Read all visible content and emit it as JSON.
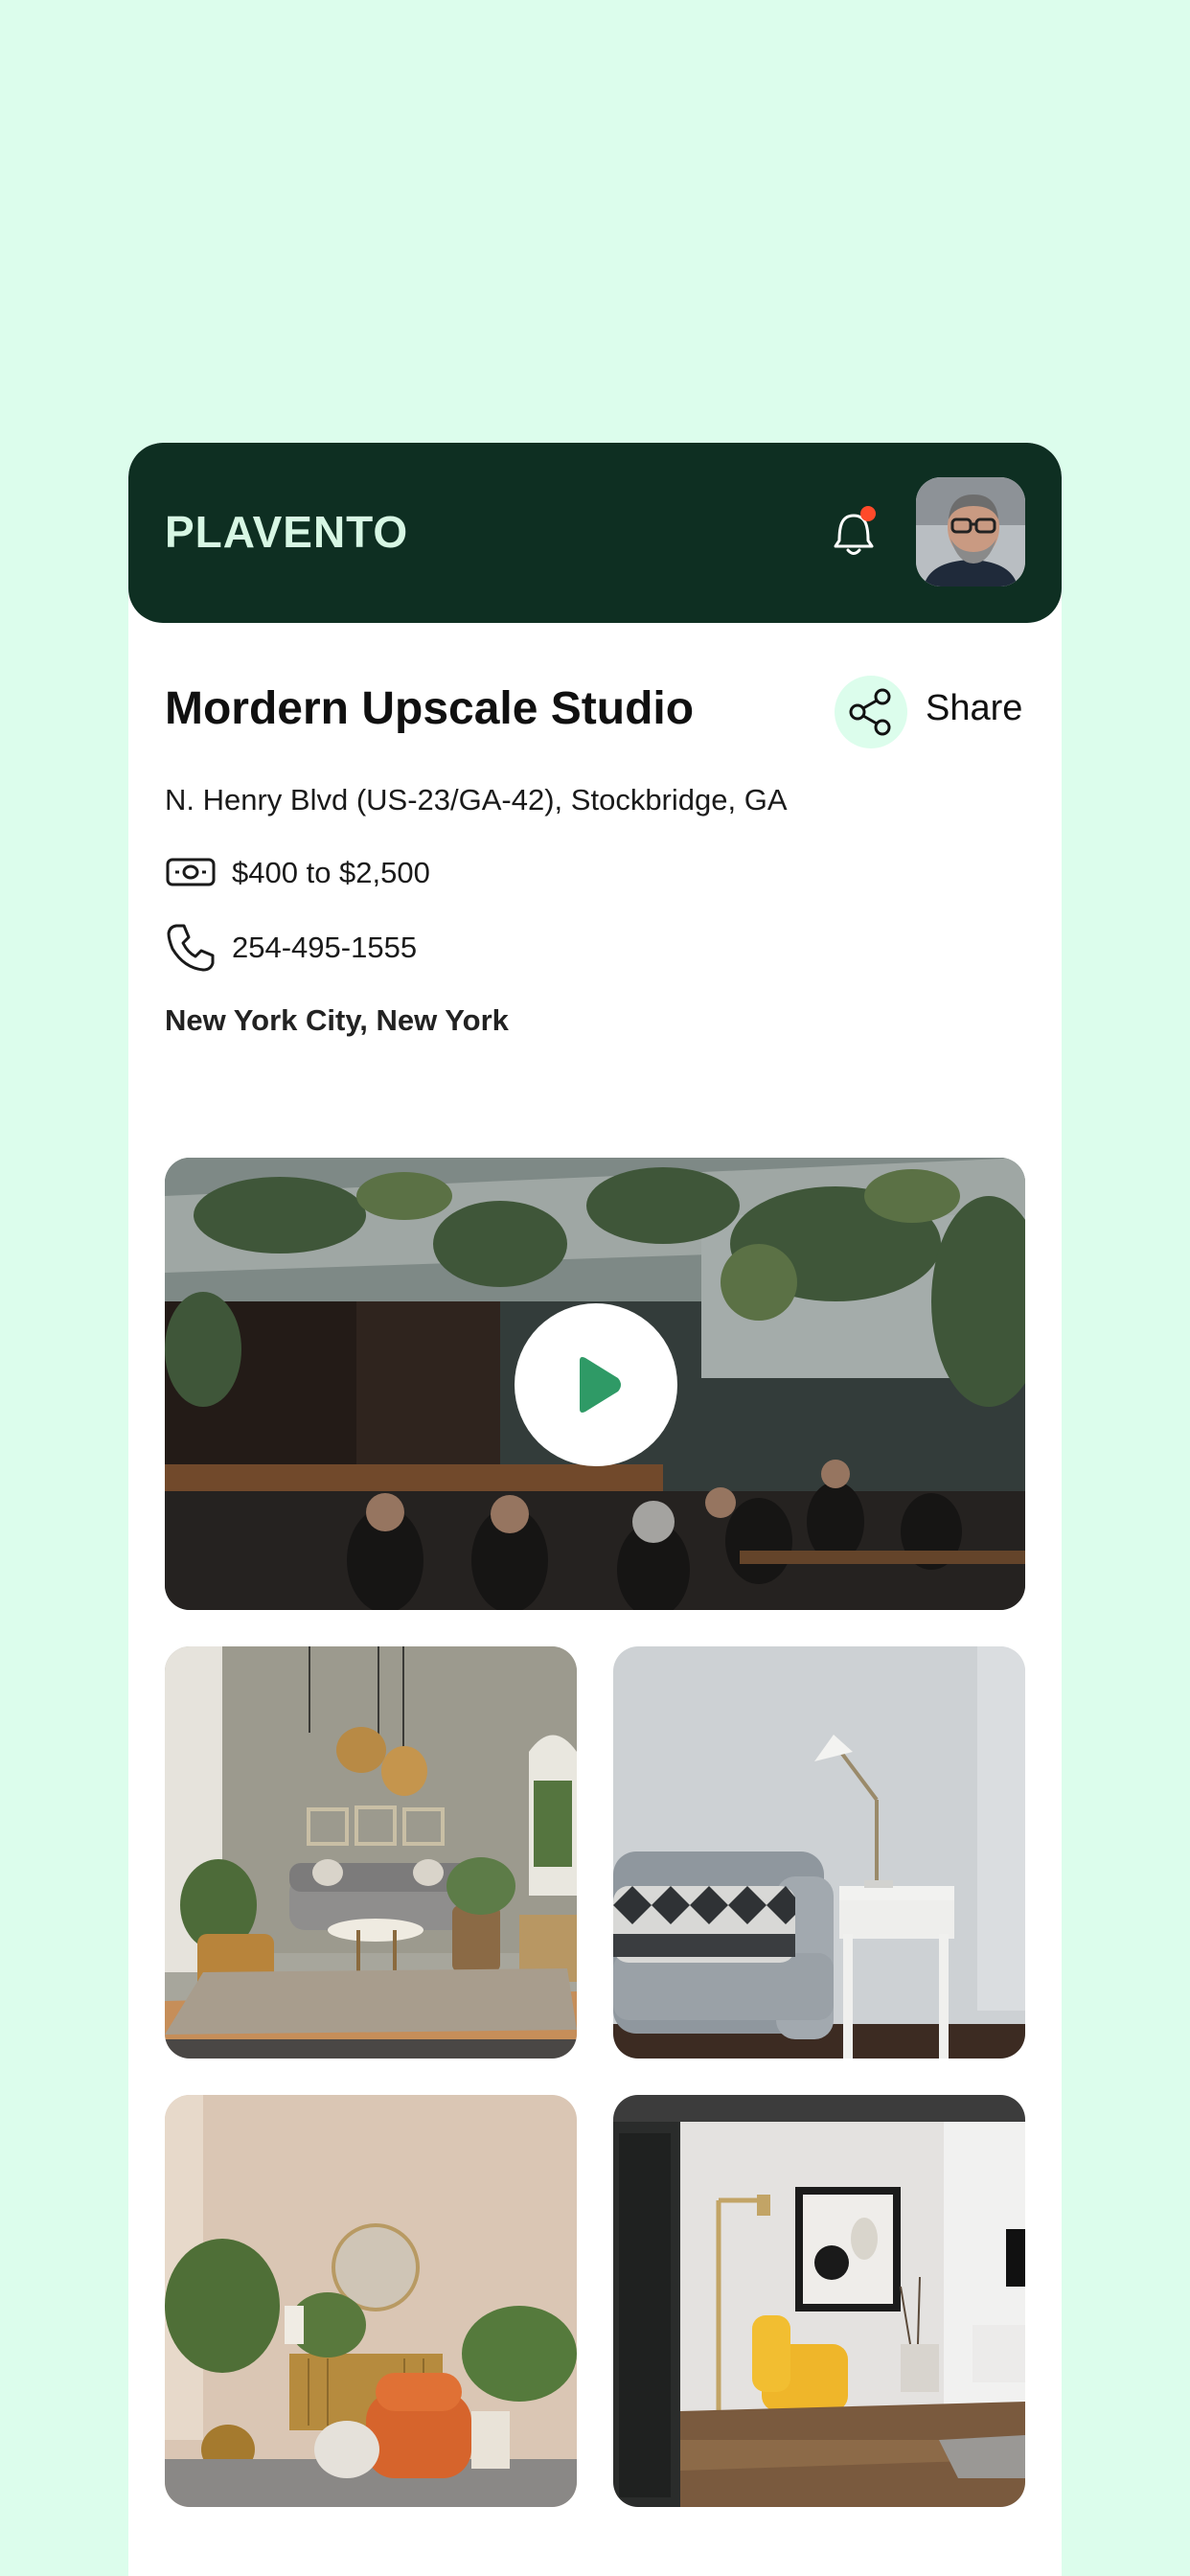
{
  "header": {
    "brand": "PLAVENTO",
    "notification_icon": "bell-icon",
    "has_unread_notification": true,
    "avatar_icon": "user-avatar"
  },
  "listing": {
    "title": "Mordern Upscale Studio",
    "share_label": "Share",
    "address": "N. Henry Blvd (US-23/GA-42), Stockbridge, GA",
    "price_range": "$400 to $2,500",
    "phone": "254-495-1555",
    "city": "New York City, New York"
  },
  "media": {
    "video": {
      "description_icon": "play-icon"
    },
    "gallery": [
      {
        "name": "living-room-photo"
      },
      {
        "name": "gray-sofa-photo"
      },
      {
        "name": "orange-chair-room-photo"
      },
      {
        "name": "yellow-chair-room-photo"
      }
    ]
  },
  "colors": {
    "page_background": "#dcfdec",
    "header_background": "#0e2f22",
    "brand_text": "#d7f7e4",
    "accent_green": "#2f9a66",
    "notification_dot": "#ff4a2a"
  }
}
